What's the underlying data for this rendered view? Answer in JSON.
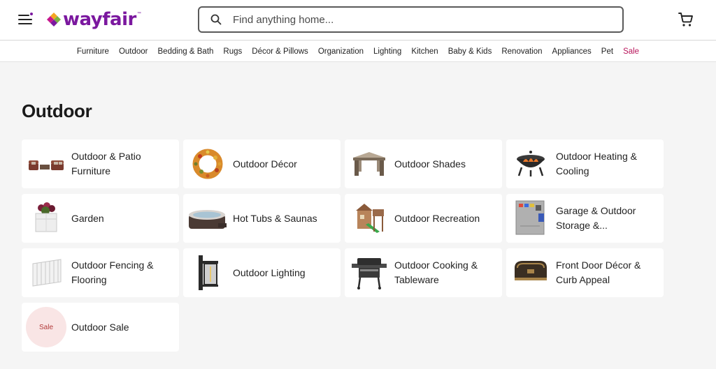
{
  "header": {
    "logo_text": "wayfair",
    "logo_tm": "™",
    "search": {
      "placeholder": "Find anything home..."
    },
    "icons": {
      "menu": "hamburger-menu-icon",
      "search": "search-icon",
      "cart": "cart-icon"
    }
  },
  "nav": {
    "items": [
      {
        "label": "Furniture"
      },
      {
        "label": "Outdoor"
      },
      {
        "label": "Bedding & Bath"
      },
      {
        "label": "Rugs"
      },
      {
        "label": "Décor & Pillows"
      },
      {
        "label": "Organization"
      },
      {
        "label": "Lighting"
      },
      {
        "label": "Kitchen"
      },
      {
        "label": "Baby & Kids"
      },
      {
        "label": "Renovation"
      },
      {
        "label": "Appliances"
      },
      {
        "label": "Pet"
      },
      {
        "label": "Sale"
      }
    ],
    "sale_color": "#b8155b"
  },
  "page": {
    "title": "Outdoor"
  },
  "categories": [
    {
      "label": "Outdoor & Patio Furniture",
      "icon": "patio-furniture-icon"
    },
    {
      "label": "Outdoor Décor",
      "icon": "wreath-icon"
    },
    {
      "label": "Outdoor Shades",
      "icon": "gazebo-icon"
    },
    {
      "label": "Outdoor Heating & Cooling",
      "icon": "fire-pit-icon"
    },
    {
      "label": "Garden",
      "icon": "planter-icon"
    },
    {
      "label": "Hot Tubs & Saunas",
      "icon": "hot-tub-icon"
    },
    {
      "label": "Outdoor Recreation",
      "icon": "playset-icon"
    },
    {
      "label": "Garage & Outdoor Storage &...",
      "icon": "storage-cabinet-icon"
    },
    {
      "label": "Outdoor Fencing & Flooring",
      "icon": "fence-icon"
    },
    {
      "label": "Outdoor Lighting",
      "icon": "lantern-icon"
    },
    {
      "label": "Outdoor Cooking & Tableware",
      "icon": "grill-icon"
    },
    {
      "label": "Front Door Décor & Curb Appeal",
      "icon": "mailbox-icon"
    },
    {
      "label": "Outdoor Sale",
      "icon": "sale-badge-icon",
      "badge": "Sale"
    }
  ],
  "colors": {
    "brand": "#7b189f",
    "page_bg": "#f5f5f5"
  }
}
